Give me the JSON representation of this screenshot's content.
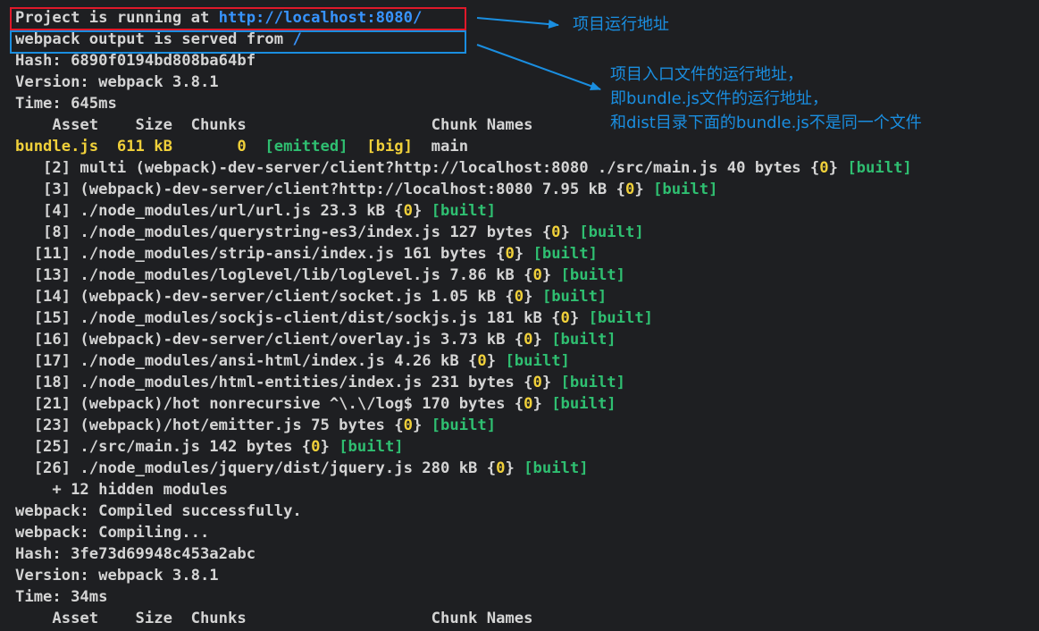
{
  "terminal": {
    "lines": [
      [
        {
          "t": "Project is running at "
        },
        {
          "t": "http://localhost:8080/",
          "c": "url"
        }
      ],
      [
        {
          "t": "webpack output is served from "
        },
        {
          "t": "/",
          "c": "url"
        }
      ],
      [
        {
          "t": "Hash: 6890f0194bd808ba64bf"
        }
      ],
      [
        {
          "t": "Version: webpack 3.8.1"
        }
      ],
      [
        {
          "t": "Time: 645ms"
        }
      ],
      [
        {
          "t": "    Asset    Size  Chunks                    Chunk Names"
        }
      ],
      [
        {
          "t": "bundle.js  611 kB       0  ",
          "c": "yellow"
        },
        {
          "t": "[emitted]",
          "c": "green"
        },
        {
          "t": "  "
        },
        {
          "t": "[big]",
          "c": "yellow"
        },
        {
          "t": "  main"
        }
      ],
      [
        {
          "t": "   [2] multi (webpack)-dev-server/client?http://localhost:8080 ./src/main.js 40 bytes {"
        },
        {
          "t": "0",
          "c": "yellow"
        },
        {
          "t": "} "
        },
        {
          "t": "[built]",
          "c": "green"
        }
      ],
      [
        {
          "t": "   [3] (webpack)-dev-server/client?http://localhost:8080 7.95 kB {"
        },
        {
          "t": "0",
          "c": "yellow"
        },
        {
          "t": "} "
        },
        {
          "t": "[built]",
          "c": "green"
        }
      ],
      [
        {
          "t": "   [4] ./node_modules/url/url.js 23.3 kB {"
        },
        {
          "t": "0",
          "c": "yellow"
        },
        {
          "t": "} "
        },
        {
          "t": "[built]",
          "c": "green"
        }
      ],
      [
        {
          "t": "   [8] ./node_modules/querystring-es3/index.js 127 bytes {"
        },
        {
          "t": "0",
          "c": "yellow"
        },
        {
          "t": "} "
        },
        {
          "t": "[built]",
          "c": "green"
        }
      ],
      [
        {
          "t": "  [11] ./node_modules/strip-ansi/index.js 161 bytes {"
        },
        {
          "t": "0",
          "c": "yellow"
        },
        {
          "t": "} "
        },
        {
          "t": "[built]",
          "c": "green"
        }
      ],
      [
        {
          "t": "  [13] ./node_modules/loglevel/lib/loglevel.js 7.86 kB {"
        },
        {
          "t": "0",
          "c": "yellow"
        },
        {
          "t": "} "
        },
        {
          "t": "[built]",
          "c": "green"
        }
      ],
      [
        {
          "t": "  [14] (webpack)-dev-server/client/socket.js 1.05 kB {"
        },
        {
          "t": "0",
          "c": "yellow"
        },
        {
          "t": "} "
        },
        {
          "t": "[built]",
          "c": "green"
        }
      ],
      [
        {
          "t": "  [15] ./node_modules/sockjs-client/dist/sockjs.js 181 kB {"
        },
        {
          "t": "0",
          "c": "yellow"
        },
        {
          "t": "} "
        },
        {
          "t": "[built]",
          "c": "green"
        }
      ],
      [
        {
          "t": "  [16] (webpack)-dev-server/client/overlay.js 3.73 kB {"
        },
        {
          "t": "0",
          "c": "yellow"
        },
        {
          "t": "} "
        },
        {
          "t": "[built]",
          "c": "green"
        }
      ],
      [
        {
          "t": "  [17] ./node_modules/ansi-html/index.js 4.26 kB {"
        },
        {
          "t": "0",
          "c": "yellow"
        },
        {
          "t": "} "
        },
        {
          "t": "[built]",
          "c": "green"
        }
      ],
      [
        {
          "t": "  [18] ./node_modules/html-entities/index.js 231 bytes {"
        },
        {
          "t": "0",
          "c": "yellow"
        },
        {
          "t": "} "
        },
        {
          "t": "[built]",
          "c": "green"
        }
      ],
      [
        {
          "t": "  [21] (webpack)/hot nonrecursive ^\\.\\/log$ 170 bytes {"
        },
        {
          "t": "0",
          "c": "yellow"
        },
        {
          "t": "} "
        },
        {
          "t": "[built]",
          "c": "green"
        }
      ],
      [
        {
          "t": "  [23] (webpack)/hot/emitter.js 75 bytes {"
        },
        {
          "t": "0",
          "c": "yellow"
        },
        {
          "t": "} "
        },
        {
          "t": "[built]",
          "c": "green"
        }
      ],
      [
        {
          "t": "  [25] ./src/main.js 142 bytes {"
        },
        {
          "t": "0",
          "c": "yellow"
        },
        {
          "t": "} "
        },
        {
          "t": "[built]",
          "c": "green"
        }
      ],
      [
        {
          "t": "  [26] ./node_modules/jquery/dist/jquery.js 280 kB {"
        },
        {
          "t": "0",
          "c": "yellow"
        },
        {
          "t": "} "
        },
        {
          "t": "[built]",
          "c": "green"
        }
      ],
      [
        {
          "t": "    + 12 hidden modules"
        }
      ],
      [
        {
          "t": "webpack: Compiled successfully."
        }
      ],
      [
        {
          "t": "webpack: Compiling..."
        }
      ],
      [
        {
          "t": "Hash: 3fe73d69948c453a2abc"
        }
      ],
      [
        {
          "t": "Version: webpack 3.8.1"
        }
      ],
      [
        {
          "t": "Time: 34ms"
        }
      ],
      [
        {
          "t": "    Asset    Size  Chunks                    Chunk Names"
        }
      ]
    ]
  },
  "annotations": {
    "running_address": "项目运行地址",
    "bundle_note_line1": "项目入口文件的运行地址，",
    "bundle_note_line2": "即bundle.js文件的运行地址，",
    "bundle_note_line3": "和dist目录下面的bundle.js不是同一个文件"
  },
  "colors": {
    "background": "#1e1f22",
    "url": "#3794ff",
    "yellow": "#f0d03a",
    "green": "#2fbf71",
    "red_box": "#e0192a",
    "blue_annotation": "#1a8ee0"
  }
}
